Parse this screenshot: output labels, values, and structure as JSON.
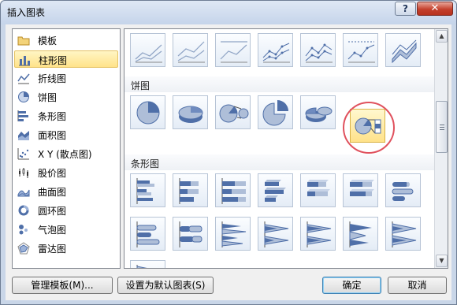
{
  "window": {
    "title": "插入图表",
    "help_label": "?",
    "close_label": "✕"
  },
  "chart_types": [
    {
      "label": "模板",
      "icon": "folder-icon"
    },
    {
      "label": "柱形图",
      "icon": "column-chart-icon",
      "selected": true
    },
    {
      "label": "折线图",
      "icon": "line-chart-icon"
    },
    {
      "label": "饼图",
      "icon": "pie-chart-icon"
    },
    {
      "label": "条形图",
      "icon": "bar-chart-icon"
    },
    {
      "label": "面积图",
      "icon": "area-chart-icon"
    },
    {
      "label": "X Y (散点图)",
      "icon": "scatter-chart-icon"
    },
    {
      "label": "股价图",
      "icon": "stock-chart-icon"
    },
    {
      "label": "曲面图",
      "icon": "surface-chart-icon"
    },
    {
      "label": "圆环图",
      "icon": "doughnut-chart-icon"
    },
    {
      "label": "气泡图",
      "icon": "bubble-chart-icon"
    },
    {
      "label": "雷达图",
      "icon": "radar-chart-icon"
    }
  ],
  "gallery": {
    "sections": {
      "pie": "饼图",
      "bar": "条形图"
    },
    "pie_selected_index": 5
  },
  "buttons": {
    "manage_templates": "管理模板(M)...",
    "set_default": "设置为默认图表(S)",
    "ok": "确定",
    "cancel": "取消"
  },
  "colors": {
    "accent_blue": "#4f6fa8",
    "selection_yellow": "#ffe38a",
    "highlight_circle": "#e0525e"
  }
}
